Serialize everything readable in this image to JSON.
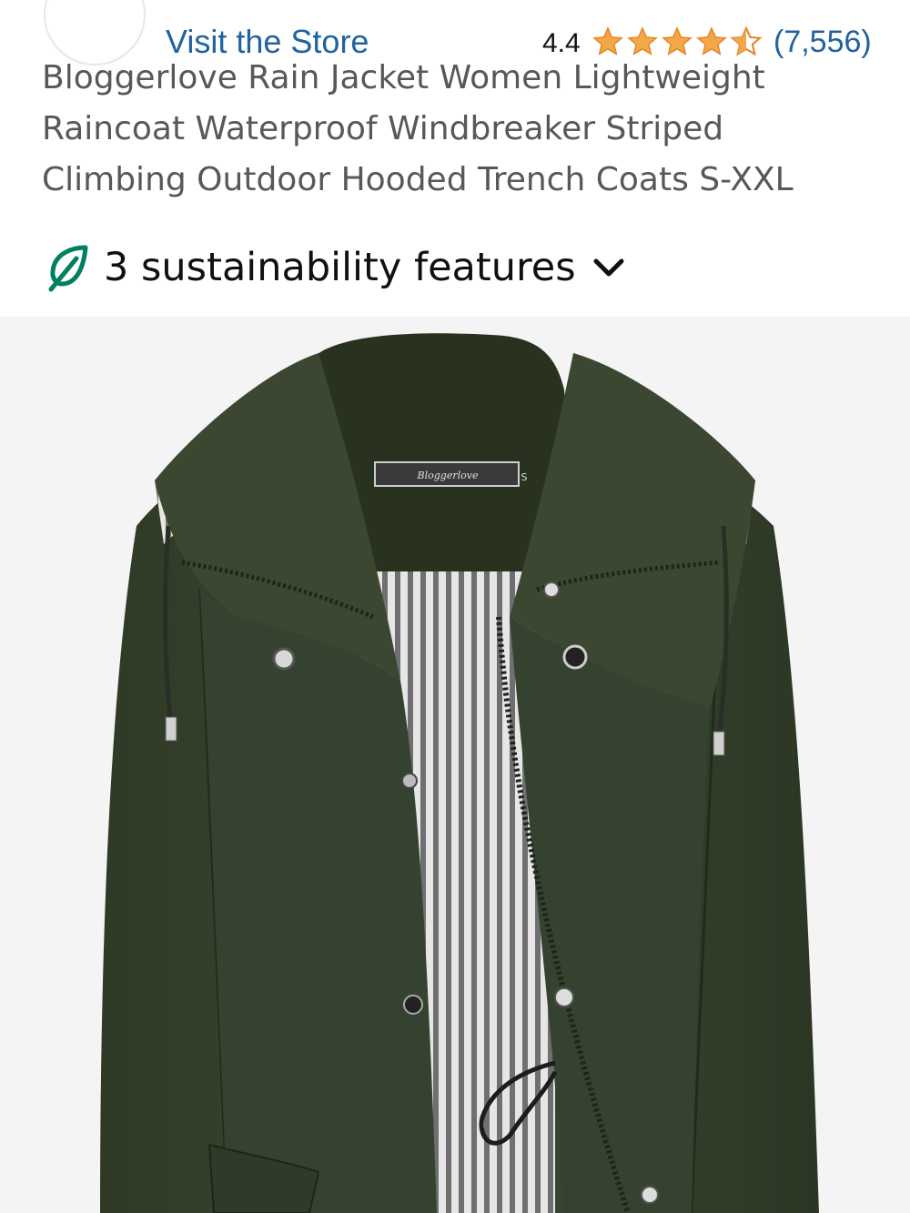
{
  "store": {
    "link_label": "Visit the Store"
  },
  "rating": {
    "value": "4.4",
    "stars_out_of_5": 4.4,
    "review_count": "(7,556)"
  },
  "product": {
    "title": "Bloggerlove Rain Jacket Women Lightweight Raincoat Waterproof Windbreaker Striped Climbing Outdoor Hooded Trench Coats S-XXL",
    "label_text": "Bloggerlove",
    "label_size": "S"
  },
  "sustainability": {
    "label": "3 sustainability features"
  },
  "colors": {
    "link": "#2162a1",
    "star": "#f3a847",
    "leaf": "#008060",
    "jacket": "#3a4630",
    "background": "#f4f4f4"
  },
  "icons": {
    "leaf": "leaf-icon",
    "chevron": "chevron-down-icon",
    "star": "star-icon"
  }
}
